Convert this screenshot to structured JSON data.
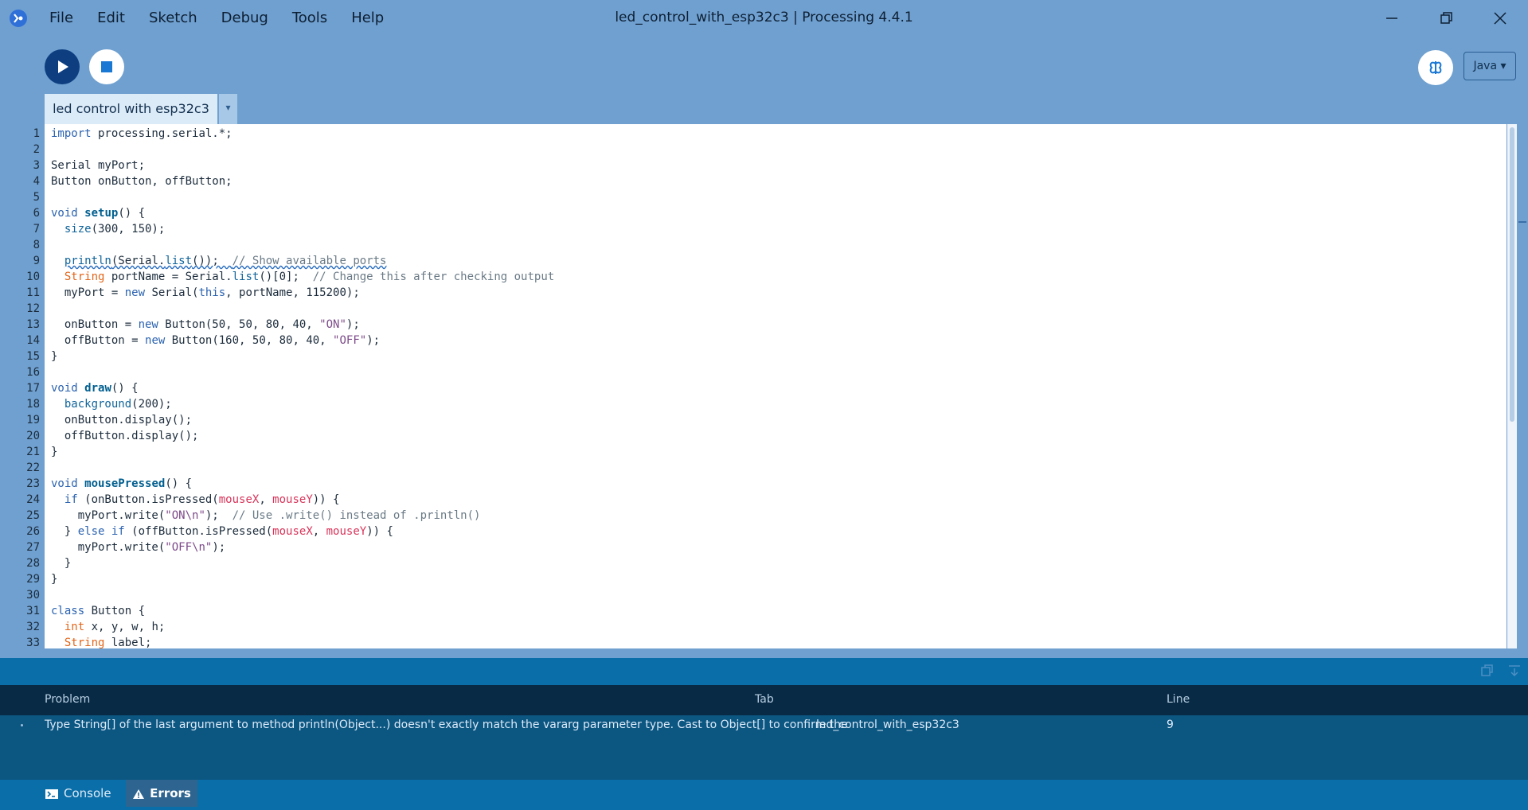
{
  "window": {
    "title": "led_control_with_esp32c3 | Processing 4.4.1"
  },
  "menubar": {
    "items": [
      "File",
      "Edit",
      "Sketch",
      "Debug",
      "Tools",
      "Help"
    ]
  },
  "toolbar": {
    "mode": "Java ▾"
  },
  "tabs": {
    "active": "led control with esp32c3",
    "menu_glyph": "▾"
  },
  "editor": {
    "line_count": 33
  },
  "problems": {
    "col_problem": "Problem",
    "col_tab": "Tab",
    "col_line": "Line",
    "rows": [
      {
        "problem": "Type String[] of the last argument to method println(Object...) doesn't exactly match the vararg parameter type. Cast to Object[] to confirm the",
        "tab": "led_control_with_esp32c3",
        "line": "9"
      }
    ]
  },
  "footer": {
    "console": "Console",
    "errors": "Errors"
  },
  "colors": {
    "bg": "#6fa0d0",
    "editor_bg": "#ffffff",
    "run": "#0e3e80",
    "stop": "#1978d4",
    "panel": "#0a6ea8",
    "problems_header": "#082a44",
    "problems_body": "#0c5682"
  }
}
